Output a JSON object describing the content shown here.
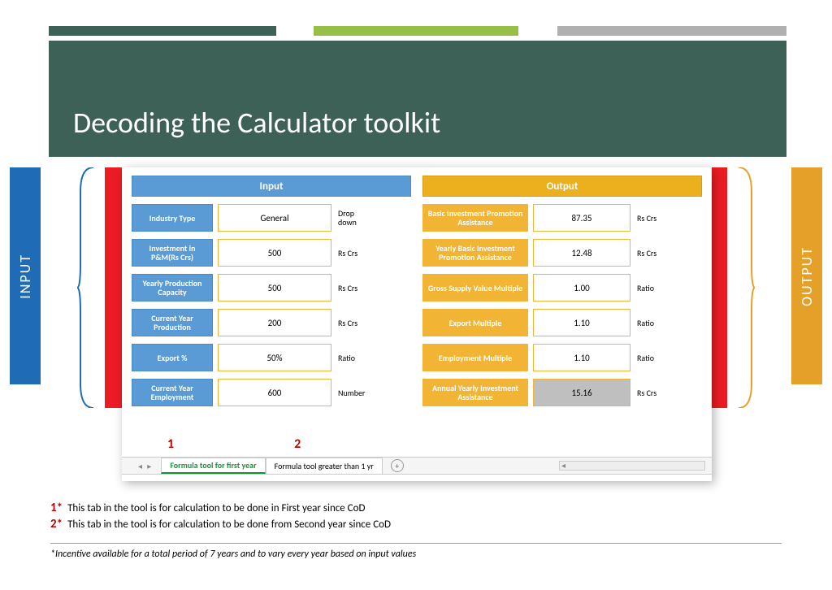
{
  "title": "Decoding the Calculator toolkit",
  "side_labels": {
    "left": "INPUT",
    "right": "OUTPUT"
  },
  "headers": {
    "input": "Input",
    "output": "Output"
  },
  "input_fields": [
    {
      "label": "Industry Type",
      "value": "General",
      "unit": "Drop down"
    },
    {
      "label": "Investment in P&M(Rs Crs)",
      "value": "500",
      "unit": "Rs Crs"
    },
    {
      "label": "Yearly Production Capacity",
      "value": "500",
      "unit": "Rs Crs"
    },
    {
      "label": "Current Year Production",
      "value": "200",
      "unit": "Rs Crs"
    },
    {
      "label": "Export %",
      "value": "50%",
      "unit": "Ratio"
    },
    {
      "label": "Current Year Employment",
      "value": "600",
      "unit": "Number"
    }
  ],
  "output_fields": [
    {
      "label": "Basic Investment Promotion Assistance",
      "value": "87.35",
      "unit": "Rs Crs",
      "grey": false
    },
    {
      "label": "Yearly Basic Investment Promotion Assistance",
      "value": "12.48",
      "unit": "Rs Crs",
      "grey": false
    },
    {
      "label": "Gross Supply Value Multiple",
      "value": "1.00",
      "unit": "Ratio",
      "grey": false
    },
    {
      "label": "Export Multiple",
      "value": "1.10",
      "unit": "Ratio",
      "grey": false
    },
    {
      "label": "Employment  Multiple",
      "value": "1.10",
      "unit": "Ratio",
      "grey": false
    },
    {
      "label": "Annual Yearly Investment Assistance",
      "value": "15.16",
      "unit": "Rs Crs",
      "grey": true
    }
  ],
  "tabs": {
    "num1": "1",
    "num2": "2",
    "active": "Formula tool for first year",
    "second": "Formula tool greater than 1 yr"
  },
  "legend": {
    "k1": "1*",
    "t1": "This tab in the tool is for calculation to be done in First year since CoD",
    "k2": "2*",
    "t2": "This tab in the tool is for calculation to be done from Second year since CoD"
  },
  "disclaimer": "*Incentive available for a total period of 7 years and to vary every year based on input values"
}
